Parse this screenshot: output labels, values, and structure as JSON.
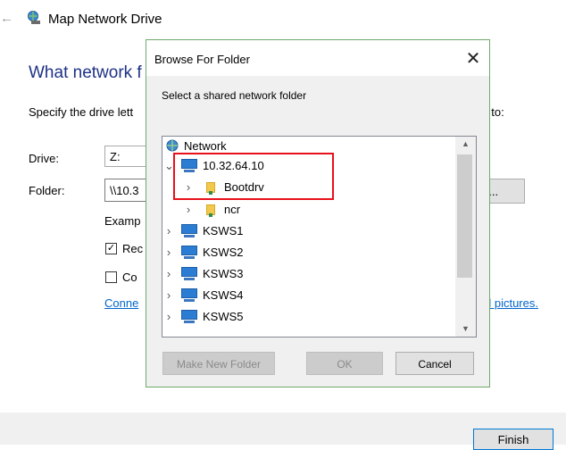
{
  "wizard": {
    "title": "Map Network Drive",
    "heading": "What network f",
    "description": "Specify the drive lett",
    "description_tail": "t to:",
    "drive_label": "Drive:",
    "drive_value": "Z:",
    "folder_label": "Folder:",
    "folder_value": "\\\\10.3",
    "browse_label": "e...",
    "example_label": "Examp",
    "reconnect_label": "Rec",
    "credentials_label": "Co",
    "connect_link": "Conne",
    "pictures_link": "d pictures.",
    "finish_label": "Finish"
  },
  "dialog": {
    "title": "Browse For Folder",
    "close_glyph": "✕",
    "prompt": "Select a shared network folder",
    "tree": {
      "root": "Network",
      "host": "10.32.64.10",
      "shares": [
        "Bootdrv",
        "ncr"
      ],
      "computers": [
        "KSWS1",
        "KSWS2",
        "KSWS3",
        "KSWS4",
        "KSWS5"
      ]
    },
    "buttons": {
      "new_folder": "Make New Folder",
      "ok": "OK",
      "cancel": "Cancel"
    }
  },
  "colors": {
    "heading": "#1e3287",
    "link": "#0066cc",
    "highlight": "#e8101a",
    "dialog_border": "#6fa96b"
  }
}
